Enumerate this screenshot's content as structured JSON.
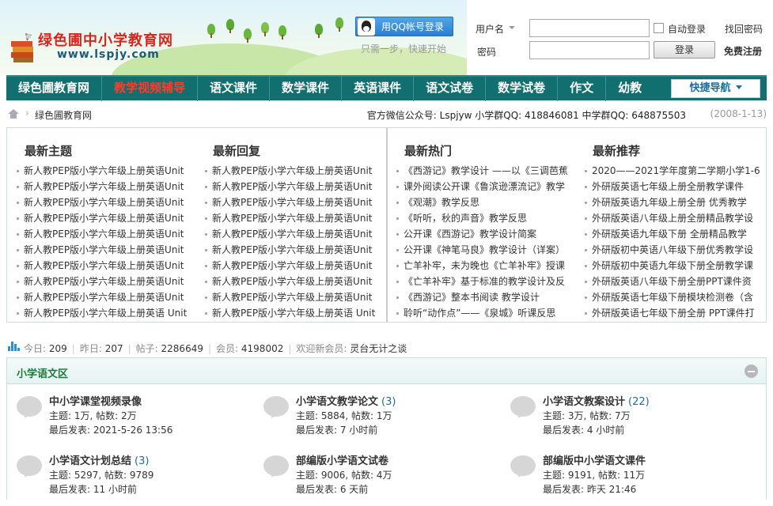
{
  "header": {
    "logo_title": "绿色圃中小学教育网",
    "logo_url": "www.lspjy.com",
    "qq_login_label": "用QQ帐号登录",
    "qq_hint": "只需一步，快速开始",
    "username_label": "用户名",
    "password_label": "密码",
    "auto_login_label": "自动登录",
    "find_password_label": "找回密码",
    "login_button": "登录",
    "register_link": "免费注册"
  },
  "nav": {
    "items": [
      "绿色圃教育网",
      "教学视频辅导",
      "语文课件",
      "数学课件",
      "英语课件",
      "语文试卷",
      "数学试卷",
      "作文",
      "幼教"
    ],
    "active_index": 1,
    "quick_nav": "快捷导航"
  },
  "breadcrumb": {
    "separator": "›",
    "site": "绿色圃教育网",
    "wechat_info": "官方微信公众号: Lspjyw 小学群QQ: 418846081 中学群QQ: 648875503",
    "date": "(2008-1-13)"
  },
  "columns": [
    {
      "title": "最新主题",
      "items": [
        "新人教PEP版小学六年级上册英语Unit",
        "新人教PEP版小学六年级上册英语Unit",
        "新人教PEP版小学六年级上册英语Unit",
        "新人教PEP版小学六年级上册英语Unit",
        "新人教PEP版小学六年级上册英语Unit",
        "新人教PEP版小学六年级上册英语Unit",
        "新人教PEP版小学六年级上册英语Unit",
        "新人教PEP版小学六年级上册英语Unit",
        "新人教PEP版小学六年级上册英语Unit",
        "新人教PEP版小学六年级上册英语 Unit"
      ]
    },
    {
      "title": "最新回复",
      "items": [
        "新人教PEP版小学六年级上册英语Unit",
        "新人教PEP版小学六年级上册英语Unit",
        "新人教PEP版小学六年级上册英语Unit",
        "新人教PEP版小学六年级上册英语Unit",
        "新人教PEP版小学六年级上册英语Unit",
        "新人教PEP版小学六年级上册英语Unit",
        "新人教PEP版小学六年级上册英语Unit",
        "新人教PEP版小学六年级上册英语Unit",
        "新人教PEP版小学六年级上册英语Unit",
        "新人教PEP版小学六年级上册英语 Unit"
      ]
    },
    {
      "title": "最新热门",
      "items": [
        "《西游记》教学设计 ——以《三调芭蕉",
        "课外阅读公开课《鲁滨逊漂流记》教学",
        "《观潮》教学反思",
        "《听听，秋的声音》教学反思",
        "公开课《西游记》教学设计简案",
        "公开课《神笔马良》教学设计（详案）",
        "亡羊补牢，未为晚也《亡羊补牢》授课",
        "《亡羊补牢》基于标准的教学设计及反",
        "《西游记》整本书阅读 教学设计",
        "聆听“动作点”——《泉城》听课反思"
      ]
    },
    {
      "title": "最新推荐",
      "items": [
        "2020——2021学年度第二学期小学1-6",
        "外研版英语七年级上册全册教学课件",
        "外研版英语九年级上册全册 优秀教学",
        "外研版英语八年级上册全册精品教学设",
        "外研版英语九年级下册 全册精品教学",
        "外研版初中英语八年级下册优秀教学设",
        "外研版初中英语九年级下册全册教学课",
        "外研版英语八年级下册全册PPT课件资",
        "外研版英语七年级下册模块检测卷（含",
        "外研版英语七年级下册全册 PPT课件打"
      ]
    }
  ],
  "stats": {
    "today_label": "今日:",
    "today": "209",
    "yesterday_label": "昨日:",
    "yesterday": "207",
    "posts_label": "帖子:",
    "posts": "2286649",
    "members_label": "会员:",
    "members": "4198002",
    "welcome_label": "欢迎新会员:",
    "new_member": "灵台无计之谈"
  },
  "section": {
    "title": "小学语文区",
    "forums": [
      {
        "name": "中小学课堂视频录像",
        "count": "",
        "line1": "主题: 1万, 帖数: 2万",
        "line2": "最后发表: 2021-5-26 13:56"
      },
      {
        "name": "小学语文教学论文",
        "count": "(3)",
        "line1": "主题: 5884, 帖数: 1万",
        "line2": "最后发表: 7 小时前"
      },
      {
        "name": "小学语文教案设计",
        "count": "(22)",
        "line1": "主题: 3万, 帖数: 7万",
        "line2": "最后发表: 4 小时前"
      },
      {
        "name": "小学语文计划总结",
        "count": "(3)",
        "line1": "主题: 5297, 帖数: 9789",
        "line2": "最后发表: 11 小时前"
      },
      {
        "name": "部编版小学语文试卷",
        "count": "",
        "line1": "主题: 9006, 帖数: 4万",
        "line2": "最后发表: 6 天前"
      },
      {
        "name": "部编版中小学语文课件",
        "count": "",
        "line1": "主题: 9191, 帖数: 11万",
        "line2": "最后发表: 昨天 21:46"
      }
    ]
  },
  "colors": {
    "nav_bg": "#11706f",
    "nav_active": "#ff3b2a",
    "logo_red": "#d8261d",
    "section_title": "#1b7c3a"
  }
}
